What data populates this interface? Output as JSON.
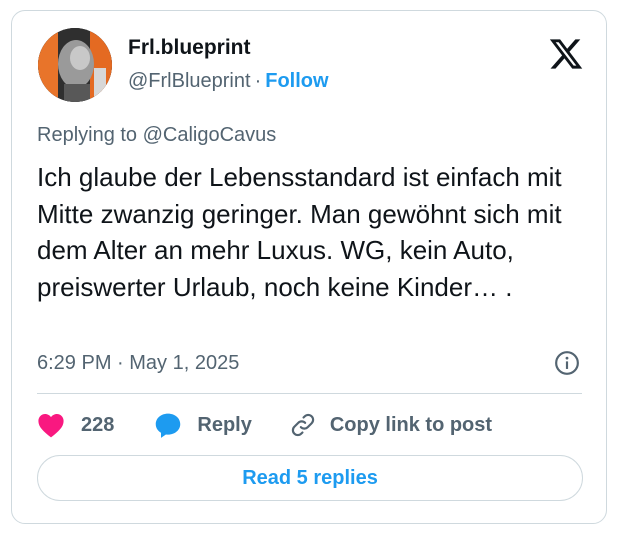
{
  "author": {
    "display_name": "Frl.blueprint",
    "handle": "@FrlBlueprint",
    "separator": "·",
    "follow_label": "Follow",
    "avatar": "profile-photo"
  },
  "platform_icon": "x-logo-icon",
  "reply_context": "Replying to @CaligoCavus",
  "tweet_text": "Ich glaube der Lebensstandard ist einfach mit Mitte zwanzig geringer. Man gewöhnt sich mit dem Alter an mehr Luxus. WG, kein Auto, preiswerter Urlaub, noch keine Kinder… .",
  "timestamp": "6:29 PM · May 1, 2025",
  "actions": {
    "like_count": "228",
    "reply_label": "Reply",
    "copy_label": "Copy link to post"
  },
  "read_replies_label": "Read 5 replies",
  "colors": {
    "accent": "#1d9bf0",
    "like": "#f91880",
    "text": "#0f1419",
    "muted": "#536471",
    "border": "#cfd9de"
  }
}
